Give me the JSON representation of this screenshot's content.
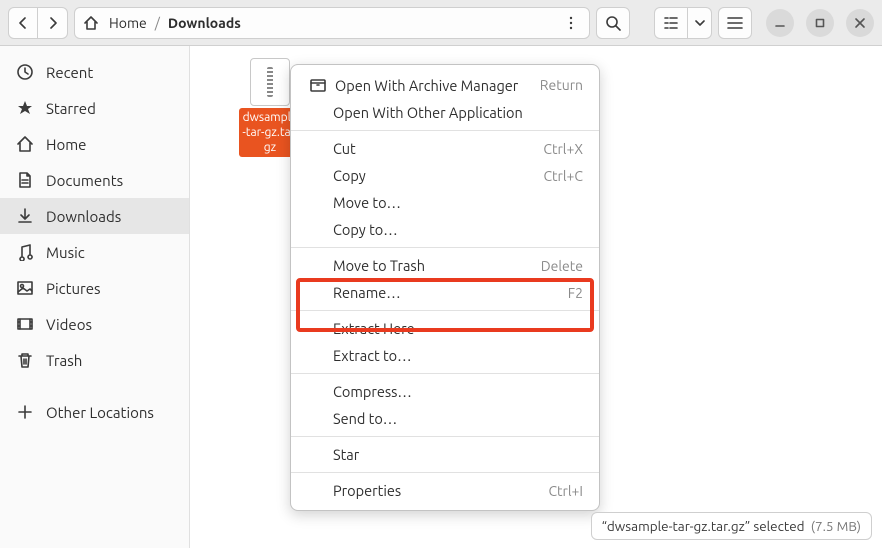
{
  "breadcrumb": {
    "home_label": "Home",
    "current": "Downloads"
  },
  "sidebar": {
    "items": [
      {
        "label": "Recent"
      },
      {
        "label": "Starred"
      },
      {
        "label": "Home"
      },
      {
        "label": "Documents"
      },
      {
        "label": "Downloads"
      },
      {
        "label": "Music"
      },
      {
        "label": "Pictures"
      },
      {
        "label": "Videos"
      },
      {
        "label": "Trash"
      }
    ],
    "other_locations": "Other Locations"
  },
  "file": {
    "name": "dwsample-tar-gz.tar.gz"
  },
  "context_menu": {
    "open_with_archive": "Open With Archive Manager",
    "open_with_archive_shortcut": "Return",
    "open_with_other": "Open With Other Application",
    "cut": "Cut",
    "cut_shortcut": "Ctrl+X",
    "copy": "Copy",
    "copy_shortcut": "Ctrl+C",
    "move_to": "Move to…",
    "copy_to": "Copy to…",
    "move_to_trash": "Move to Trash",
    "trash_shortcut": "Delete",
    "rename": "Rename…",
    "rename_shortcut": "F2",
    "extract_here": "Extract Here",
    "extract_to": "Extract to…",
    "compress": "Compress…",
    "send_to": "Send to…",
    "star": "Star",
    "properties": "Properties",
    "properties_shortcut": "Ctrl+I"
  },
  "status": {
    "text": "“dwsample-tar-gz.tar.gz” selected",
    "size": "(7.5 MB)"
  }
}
